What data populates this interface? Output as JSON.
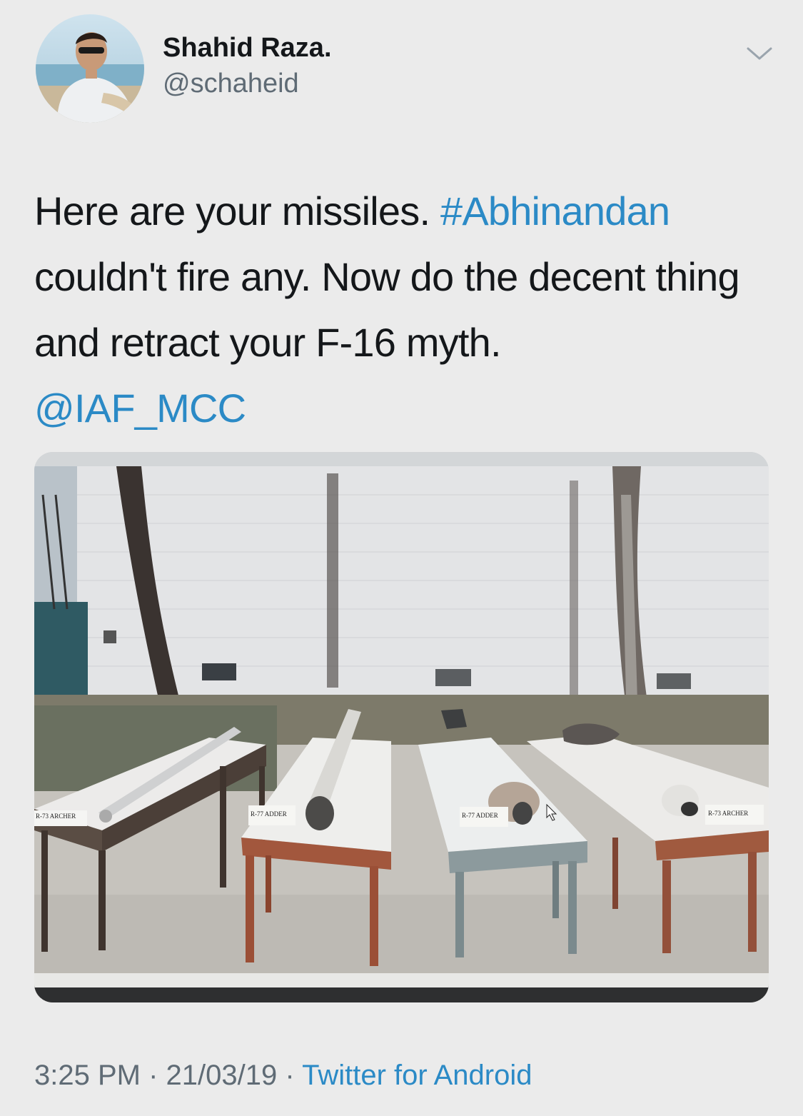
{
  "user": {
    "display_name": "Shahid Raza.",
    "handle": "@schaheid"
  },
  "tweet": {
    "text_part1": "Here are your missiles. ",
    "hashtag": "#Abhinandan",
    "text_part2": " couldn't fire any. Now do the decent thing and retract your F-16 myth.",
    "mention": "@IAF_MCC"
  },
  "media": {
    "table_labels": [
      "R-73 ARCHER",
      "R-77 ADDER",
      "R-77 ADDER",
      "R-73 ARCHER"
    ]
  },
  "meta": {
    "time": "3:25 PM",
    "separator": "·",
    "date": "21/03/19",
    "source": "Twitter for Android"
  },
  "icons": {
    "menu": "chevron-down-icon"
  },
  "colors": {
    "link": "#2b8ac6",
    "background": "#ebebeb"
  }
}
